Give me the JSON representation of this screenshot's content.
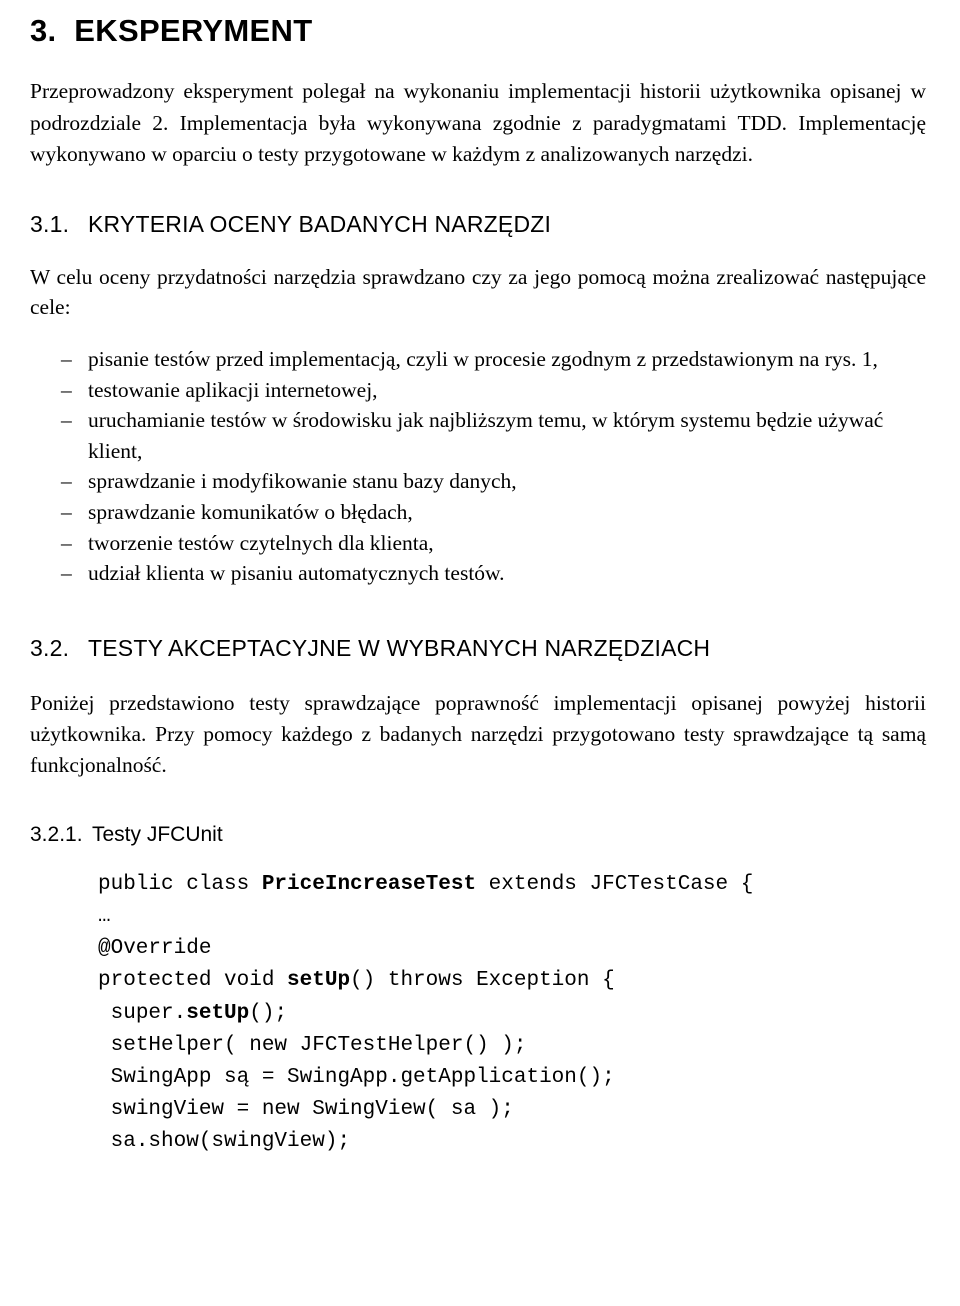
{
  "chapter": {
    "number": "3.",
    "title": "EKSPERYMENT",
    "full": "3.  EKSPERYMENT"
  },
  "intro_paragraph": "Przeprowadzony eksperyment polegał na wykonaniu implementacji historii użytkownika opisanej w podrozdziale 2. Implementacja była wykonywana zgodnie z paradygmatami TDD. Implementację wykonywano w oparciu o testy przygotowane w każdym z analizowanych narzędzi.",
  "section_31": {
    "number": "3.1.",
    "title": "KRYTERIA OCENY BADANYCH NARZĘDZI",
    "lead": "W celu oceny przydatności narzędzia sprawdzano czy za jego pomocą można zrealizować następujące cele:",
    "dash": "–",
    "items": [
      "pisanie testów przed implementacją, czyli w procesie zgodnym z przedstawionym na rys. 1,",
      "testowanie aplikacji internetowej,",
      "uruchamianie testów w środowisku jak najbliższym temu, w którym systemu będzie używać klient,",
      "sprawdzanie i modyfikowanie stanu bazy danych,",
      "sprawdzanie komunikatów o błędach,",
      "tworzenie testów czytelnych dla klienta,",
      "udział klienta w pisaniu automatycznych testów."
    ]
  },
  "section_32": {
    "number": "3.2.",
    "title": "TESTY AKCEPTACYJNE W WYBRANYCH NARZĘDZIACH",
    "paragraph": "Poniżej przedstawiono testy sprawdzające poprawność implementacji opisanej powyżej historii użytkownika. Przy pomocy każdego z badanych narzędzi przygotowano testy sprawdzające tą samą funkcjonalność."
  },
  "subsection_321": {
    "number": "3.2.1.",
    "title": "Testy JFCUnit",
    "code_lines": [
      {
        "text": "public class ",
        "bold": false
      },
      {
        "text": "PriceIncreaseTest",
        "bold": true
      },
      {
        "text": " extends JFCTestCase {",
        "bold": false
      }
    ],
    "code": "public class PriceIncreaseTest extends JFCTestCase {\n…\n@Override\nprotected void setUp() throws Exception {\n super.setUp();\n setHelper( new JFCTestHelper() );\n SwingApp są = SwingApp.getApplication();\n swingView = new SwingView( sa );\n sa.show(swingView);"
  }
}
